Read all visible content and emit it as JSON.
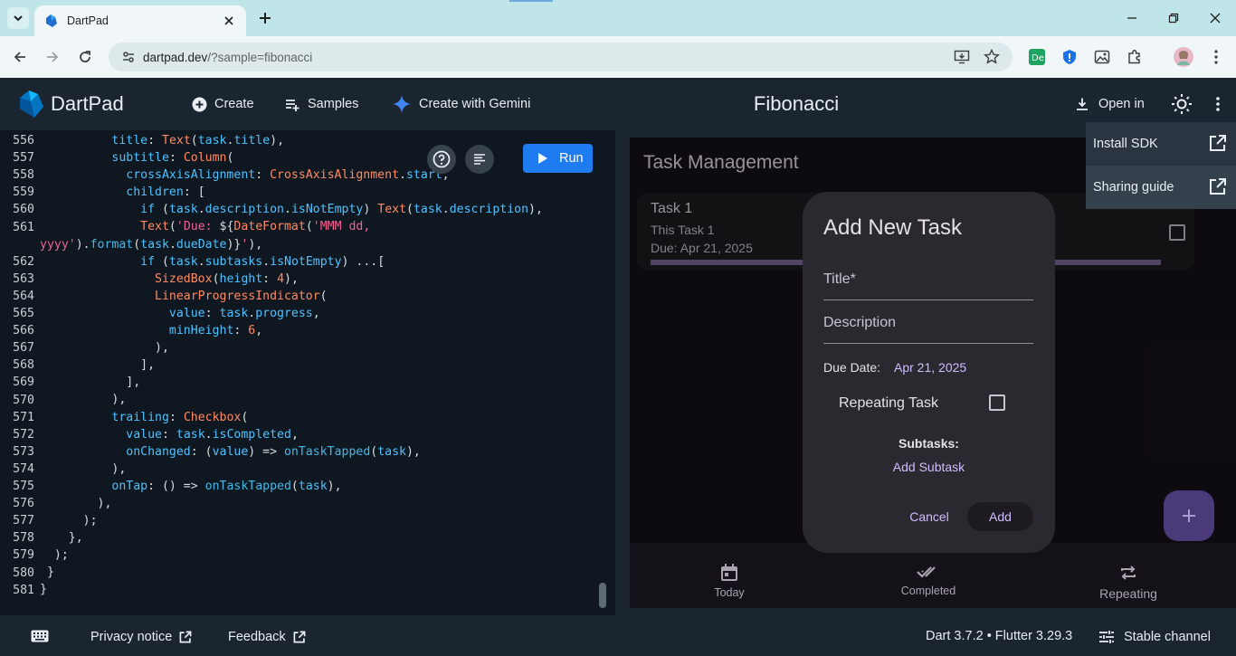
{
  "browser": {
    "tab_title": "DartPad",
    "url_host": "dartpad.dev",
    "url_path": "/?sample=fibonacci"
  },
  "header": {
    "app_name": "DartPad",
    "create_label": "Create",
    "samples_label": "Samples",
    "gemini_label": "Create with Gemini",
    "title": "Fibonacci",
    "open_in_label": "Open in"
  },
  "menu": {
    "items": [
      {
        "label": "Install SDK",
        "icon": "open-in-new-icon"
      },
      {
        "label": "Sharing guide",
        "icon": "open-in-new-icon"
      }
    ]
  },
  "editor": {
    "run_label": "Run",
    "line_numbers": [
      "556",
      "557",
      "558",
      "559",
      "560",
      "561",
      "",
      "562",
      "563",
      "564",
      "565",
      "566",
      "567",
      "568",
      "569",
      "570",
      "571",
      "572",
      "573",
      "574",
      "575",
      "576",
      "577",
      "578",
      "579",
      "580",
      "581"
    ]
  },
  "app": {
    "title": "Task Management",
    "task": {
      "name": "Task 1",
      "description": "This Task 1",
      "due": "Due: Apr 21, 2025",
      "progress": 1.0
    },
    "nav": [
      {
        "label": "Today",
        "icon": "calendar-icon"
      },
      {
        "label": "Completed",
        "icon": "done-all-icon"
      },
      {
        "label": "Repeating",
        "icon": "repeat-icon"
      }
    ]
  },
  "dialog": {
    "title": "Add New Task",
    "title_placeholder": "Title*",
    "description_placeholder": "Description",
    "due_label": "Due Date:",
    "due_value": "Apr 21, 2025",
    "repeating_label": "Repeating Task",
    "subtasks_label": "Subtasks:",
    "add_subtask_label": "Add Subtask",
    "cancel_label": "Cancel",
    "add_label": "Add"
  },
  "statusbar": {
    "privacy_label": "Privacy notice",
    "feedback_label": "Feedback",
    "version": "Dart 3.7.2 • Flutter 3.29.3",
    "channel_label": "Stable channel"
  },
  "colors": {
    "accent": "#1e7bf0",
    "dialog_link": "#d0bcff",
    "editor_bg": "#0f1820"
  }
}
